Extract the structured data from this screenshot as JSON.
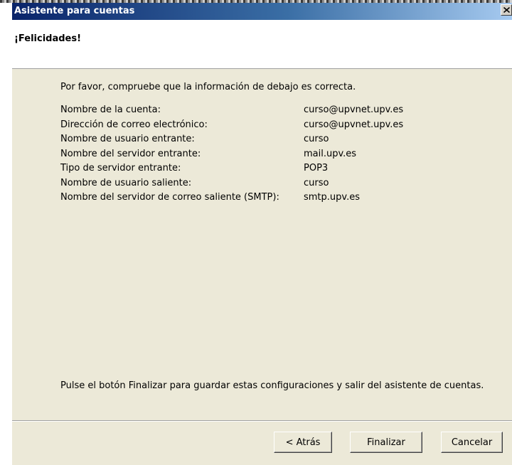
{
  "window": {
    "title": "Asistente para cuentas"
  },
  "header": {
    "title": "¡Felicidades!"
  },
  "content": {
    "intro": "Por favor, compruebe que la información de debajo es correcta.",
    "summary": [
      {
        "label": "Nombre de la cuenta:",
        "value": "curso@upvnet.upv.es"
      },
      {
        "label": "Dirección de correo electrónico:",
        "value": "curso@upvnet.upv.es"
      },
      {
        "label": "Nombre de usuario entrante:",
        "value": "curso"
      },
      {
        "label": "Nombre del servidor entrante:",
        "value": "mail.upv.es"
      },
      {
        "label": "Tipo de servidor entrante:",
        "value": "POP3"
      },
      {
        "label": "Nombre de usuario saliente:",
        "value": "curso"
      },
      {
        "label": "Nombre del servidor de correo saliente (SMTP):",
        "value": "smtp.upv.es"
      }
    ],
    "footer": "Pulse el botón Finalizar para guardar estas configuraciones y salir del asistente de cuentas."
  },
  "buttons": {
    "back": "< Atrás",
    "finish": "Finalizar",
    "cancel": "Cancelar"
  },
  "icons": {
    "close": "close-icon"
  }
}
